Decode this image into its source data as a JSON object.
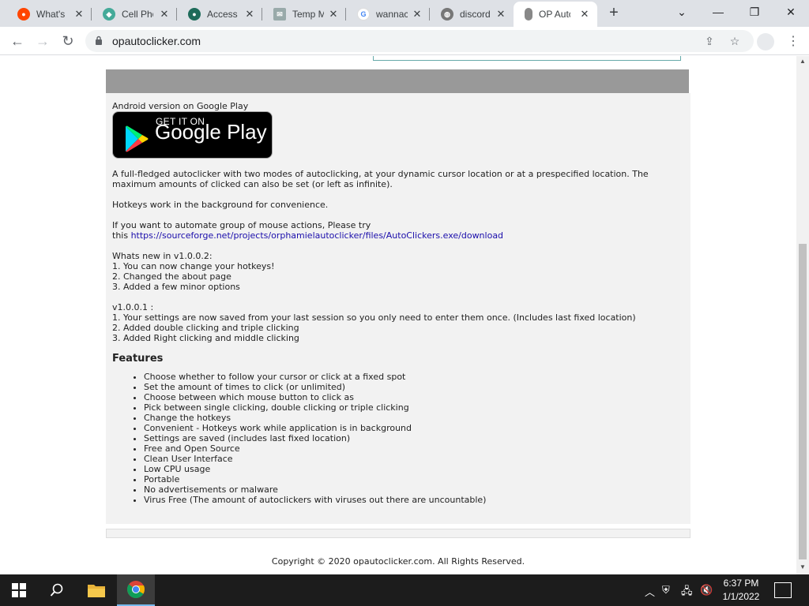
{
  "browser": {
    "tabs": [
      {
        "title": "What's I",
        "favicon_color": "#ff4500",
        "favicon_glyph": "reddit-icon"
      },
      {
        "title": "Cell Pho",
        "favicon_color": "#4a9",
        "favicon_glyph": "cat-icon"
      },
      {
        "title": "Access d",
        "favicon_color": "#1e6b5a",
        "favicon_glyph": "circle-icon"
      },
      {
        "title": "Temp M",
        "favicon_color": "#9aa",
        "favicon_glyph": "mail-icon"
      },
      {
        "title": "wannac",
        "favicon_color": "#4285f4",
        "favicon_glyph": "google-icon"
      },
      {
        "title": "discord",
        "favicon_color": "#777",
        "favicon_glyph": "globe-icon"
      },
      {
        "title": "OP Autc",
        "favicon_color": "#777",
        "favicon_glyph": "mouse-icon",
        "active": true
      }
    ],
    "new_tab": "+",
    "window_buttons": {
      "dropdown": "⌄",
      "minimize": "—",
      "maximize": "❐",
      "close": "✕"
    },
    "url": "opautoclicker.com"
  },
  "page": {
    "android_label": "Android version on Google Play",
    "badge": {
      "get_it_on": "GET IT ON",
      "store": "Google Play"
    },
    "description": "A full-fledged autoclicker with two modes of autoclicking, at your dynamic cursor location or at a prespecified location. The maximum amounts of clicked can also be set (or left as infinite).",
    "hotkeys": "Hotkeys work in the background for convenience.",
    "automate_prefix": "If you want to automate group of mouse actions, Please try",
    "automate_this": "this",
    "automate_link": "https://sourceforge.net/projects/orphamielautoclicker/files/AutoClickers.exe/download",
    "whats_new": {
      "heading": "Whats new in v1.0.0.2:",
      "items": [
        "1. You can now change your hotkeys!",
        "2. Changed the about page",
        "3. Added a few minor options"
      ]
    },
    "v1001": {
      "heading": "v1.0.0.1 :",
      "items": [
        "1. Your settings are now saved from your last session so you only need to enter them once. (Includes last fixed location)",
        "2. Added double clicking and triple clicking",
        "3. Added Right clicking and middle clicking"
      ]
    },
    "features_heading": "Features",
    "features": [
      "Choose whether to follow your cursor or click at a fixed spot",
      "Set the amount of times to click (or unlimited)",
      "Choose between which mouse button to click as",
      "Pick between single clicking, double clicking or triple clicking",
      "Change the hotkeys",
      "Convenient - Hotkeys work while application is in background",
      "Settings are saved (includes last fixed location)",
      "Free and Open Source",
      "Clean User Interface",
      "Low CPU usage",
      "Portable",
      "No advertisements or malware",
      "Virus Free (The amount of autoclickers with viruses out there are uncountable)"
    ],
    "copyright": "Copyright © 2020 opautoclicker.com. All Rights Reserved."
  },
  "taskbar": {
    "time": "6:37 PM",
    "date": "1/1/2022"
  }
}
